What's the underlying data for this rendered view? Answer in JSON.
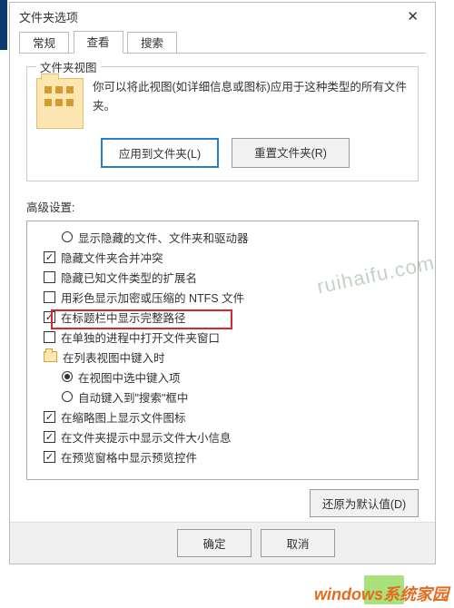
{
  "window_title": "文件夹选项",
  "tabs": {
    "general": "常规",
    "view": "查看",
    "search": "搜索"
  },
  "folder_view": {
    "group": "文件夹视图",
    "text": "你可以将此视图(如详细信息或图标)应用于这种类型的所有文件夹。",
    "apply": "应用到文件夹(L)",
    "reset": "重置文件夹(R)"
  },
  "advanced": {
    "label": "高级设置:",
    "items": [
      {
        "type": "radio",
        "checked": false,
        "indent": 1,
        "text": "显示隐藏的文件、文件夹和驱动器"
      },
      {
        "type": "checkbox",
        "checked": true,
        "indent": 0,
        "text": "隐藏文件夹合并冲突"
      },
      {
        "type": "checkbox",
        "checked": false,
        "indent": 0,
        "text": "隐藏已知文件类型的扩展名"
      },
      {
        "type": "checkbox",
        "checked": false,
        "indent": 0,
        "text": "用彩色显示加密或压缩的 NTFS 文件"
      },
      {
        "type": "checkbox",
        "checked": true,
        "indent": 0,
        "text": "在标题栏中显示完整路径"
      },
      {
        "type": "checkbox",
        "checked": false,
        "indent": 0,
        "text": "在单独的进程中打开文件夹窗口"
      },
      {
        "type": "folder",
        "checked": false,
        "indent": 0,
        "text": "在列表视图中键入时"
      },
      {
        "type": "radio",
        "checked": true,
        "indent": 1,
        "text": "在视图中选中键入项"
      },
      {
        "type": "radio",
        "checked": false,
        "indent": 1,
        "text": "自动键入到\"搜索\"框中"
      },
      {
        "type": "checkbox",
        "checked": true,
        "indent": 0,
        "text": "在缩略图上显示文件图标"
      },
      {
        "type": "checkbox",
        "checked": true,
        "indent": 0,
        "text": "在文件夹提示中显示文件大小信息"
      },
      {
        "type": "checkbox",
        "checked": true,
        "indent": 0,
        "text": "在预览窗格中显示预览控件"
      }
    ],
    "restore": "还原为默认值(D)"
  },
  "footer": {
    "ok": "确定",
    "cancel": "取消"
  },
  "watermarks": {
    "w1": "ruihaifu.com",
    "w2": "windows系统家园"
  }
}
